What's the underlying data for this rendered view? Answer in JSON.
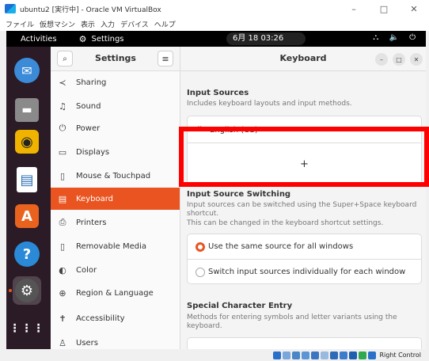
{
  "vbox": {
    "title": "ubuntu2 [実行中] - Oracle VM VirtualBox",
    "controls": [
      "–",
      "□",
      "✕"
    ],
    "menu": [
      "ファイル",
      "仮想マシン",
      "表示",
      "入力",
      "デバイス",
      "ヘルプ"
    ],
    "host_key": "Right Control"
  },
  "topbar": {
    "activities": "Activities",
    "app_name": "Settings",
    "clock": "6月 18 03:26",
    "status_icons": "⛬ 🔈 ⏻"
  },
  "dock": {
    "items": [
      {
        "name": "thunderbird-icon",
        "color": "#3b8bd9",
        "glyph": "✉"
      },
      {
        "name": "files-icon",
        "color": "#8a8a8a",
        "glyph": "▬"
      },
      {
        "name": "rhythmbox-icon",
        "color": "#f0b400",
        "glyph": "◉"
      },
      {
        "name": "libreoffice-writer-icon",
        "color": "#2b6fb5",
        "glyph": "▤"
      },
      {
        "name": "software-center-icon",
        "color": "#e9631f",
        "glyph": "A"
      },
      {
        "name": "help-icon",
        "color": "#2a8ad8",
        "glyph": "?"
      },
      {
        "name": "settings-icon",
        "color": "#555555",
        "glyph": "⚙"
      },
      {
        "name": "show-apps-icon",
        "color": "transparent",
        "glyph": "⋮⋮⋮"
      }
    ]
  },
  "settings": {
    "sidebar_title": "Settings",
    "search_icon": "⌕",
    "menu_icon": "≡",
    "items": [
      {
        "icon": "≺",
        "label": "Sharing",
        "name": "sharing"
      },
      {
        "icon": "♫",
        "label": "Sound",
        "name": "sound"
      },
      {
        "icon": "⏻",
        "label": "Power",
        "name": "power"
      },
      {
        "icon": "▭",
        "label": "Displays",
        "name": "displays"
      },
      {
        "icon": "▯",
        "label": "Mouse & Touchpad",
        "name": "mouse-touchpad"
      },
      {
        "icon": "▤",
        "label": "Keyboard",
        "name": "keyboard",
        "active": true
      },
      {
        "icon": "⎙",
        "label": "Printers",
        "name": "printers"
      },
      {
        "icon": "▯",
        "label": "Removable Media",
        "name": "removable-media"
      },
      {
        "icon": "◐",
        "label": "Color",
        "name": "color"
      },
      {
        "icon": "⊕",
        "label": "Region & Language",
        "name": "region-language"
      },
      {
        "icon": "✝",
        "label": "Accessibility",
        "name": "accessibility"
      },
      {
        "icon": "♙",
        "label": "Users",
        "name": "users"
      }
    ]
  },
  "keyboard": {
    "title": "Keyboard",
    "window_buttons": [
      "–",
      "□",
      "✕"
    ],
    "input_sources_title": "Input Sources",
    "input_sources_desc": "Includes keyboard layouts and input methods.",
    "source_english": "English (US)",
    "add_label": "+",
    "switching_title": "Input Source Switching",
    "switching_desc_1": "Input sources can be switched using the Super+Space keyboard shortcut.",
    "switching_desc_2": "This can be changed in the keyboard shortcut settings.",
    "option_same": "Use the same source for all windows",
    "option_individual": "Switch input sources individually for each window",
    "special_title": "Special Character Entry",
    "special_desc": "Methods for entering symbols and letter variants using the keyboard."
  },
  "colors": {
    "accent": "#e95420",
    "highlight": "#ff0000"
  }
}
